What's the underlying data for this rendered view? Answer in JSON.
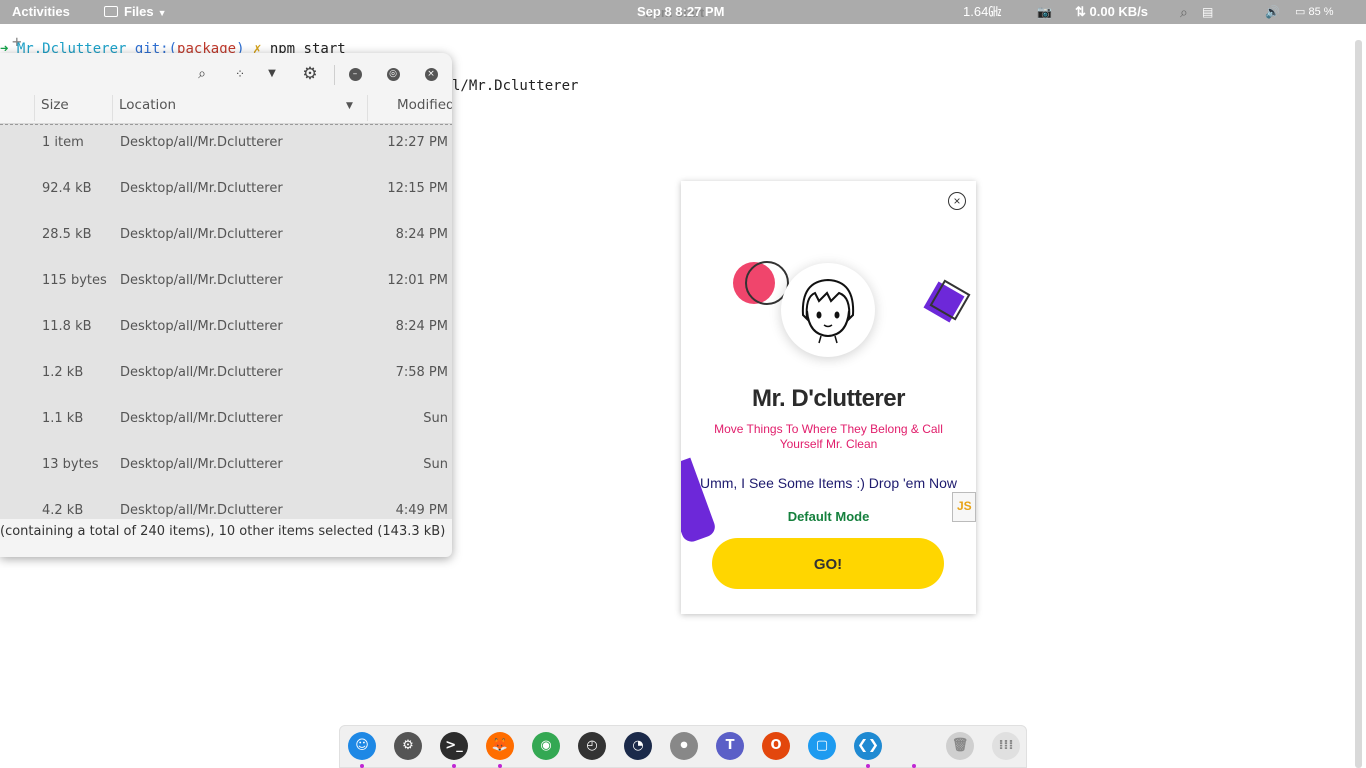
{
  "topbar": {
    "activities": "Activities",
    "files_menu": "Files",
    "clock": "Sep 8  8:27 PM",
    "window_title_ghost": "npm start",
    "cpu_freq": "1.64㎓",
    "net_speed": "⇅ 0.00 KB/s",
    "battery": "85 %"
  },
  "terminal": {
    "line1_arrow": "➜",
    "line1_dir": "Mr.Dclutterer",
    "line1_git": "git:(",
    "line1_branch": "package",
    "line1_git_close": ")",
    "line1_x": "✗",
    "line1_cmd": "npm start",
    "line2": "l/Mr.Dclutterer"
  },
  "files_window": {
    "columns": {
      "size": "Size",
      "location": "Location",
      "modified": "Modified"
    },
    "rows": [
      {
        "size": "1 item",
        "location": "Desktop/all/Mr.Dclutterer",
        "modified": "12:27 PM"
      },
      {
        "size": "92.4 kB",
        "location": "Desktop/all/Mr.Dclutterer",
        "modified": "12:15 PM"
      },
      {
        "size": "28.5 kB",
        "location": "Desktop/all/Mr.Dclutterer",
        "modified": "8:24 PM"
      },
      {
        "size": "115 bytes",
        "location": "Desktop/all/Mr.Dclutterer",
        "modified": "12:01 PM"
      },
      {
        "size": "11.8 kB",
        "location": "Desktop/all/Mr.Dclutterer",
        "modified": "8:24 PM"
      },
      {
        "size": "1.2 kB",
        "location": "Desktop/all/Mr.Dclutterer",
        "modified": "7:58 PM"
      },
      {
        "size": "1.1 kB",
        "location": "Desktop/all/Mr.Dclutterer",
        "modified": "Sun"
      },
      {
        "size": "13 bytes",
        "location": "Desktop/all/Mr.Dclutterer",
        "modified": "Sun"
      },
      {
        "size": "4.2 kB",
        "location": "Desktop/all/Mr.Dclutterer",
        "modified": "4:49 PM"
      }
    ],
    "status": "(containing a total of 240 items), 10 other items selected (143.3 kB)"
  },
  "app": {
    "title": "Mr. D'clutterer",
    "subtitle": "Move Things To Where They Belong & Call Yourself Mr. Clean",
    "prompt": "Umm, I See Some Items :) Drop 'em Now",
    "file_badge": "JS",
    "mode": "Default Mode",
    "go_label": "GO!",
    "colors": {
      "go_button": "#ffd600",
      "subtitle": "#e11d6b",
      "mode": "#15803d",
      "accent_purple": "#6d28d9",
      "accent_pink": "#f0456c"
    }
  },
  "dock": {
    "items": [
      {
        "name": "finder",
        "color": "#1e88e5",
        "running": true
      },
      {
        "name": "settings",
        "color": "#555555",
        "running": false
      },
      {
        "name": "terminal",
        "color": "#2d2d2d",
        "running": true
      },
      {
        "name": "firefox",
        "color": "#ff6d00",
        "running": true
      },
      {
        "name": "chrome",
        "color": "#34a853",
        "running": false
      },
      {
        "name": "disk-usage",
        "color": "#333333",
        "running": false
      },
      {
        "name": "speedometer",
        "color": "#1b2a4a",
        "running": false
      },
      {
        "name": "toggle",
        "color": "#888888",
        "running": false
      },
      {
        "name": "teams",
        "color": "#5b5fc7",
        "running": false
      },
      {
        "name": "office",
        "color": "#e3470d",
        "running": false
      },
      {
        "name": "notes",
        "color": "#1e9bf0",
        "running": false
      },
      {
        "name": "vscode",
        "color": "#1f8ad2",
        "running": true
      },
      {
        "name": "blank",
        "color": "#f0f0f0",
        "running": true
      },
      {
        "name": "trash",
        "color": "#cfcfcf",
        "running": false
      },
      {
        "name": "app-grid",
        "color": "#e0e0e0",
        "running": false
      }
    ]
  }
}
